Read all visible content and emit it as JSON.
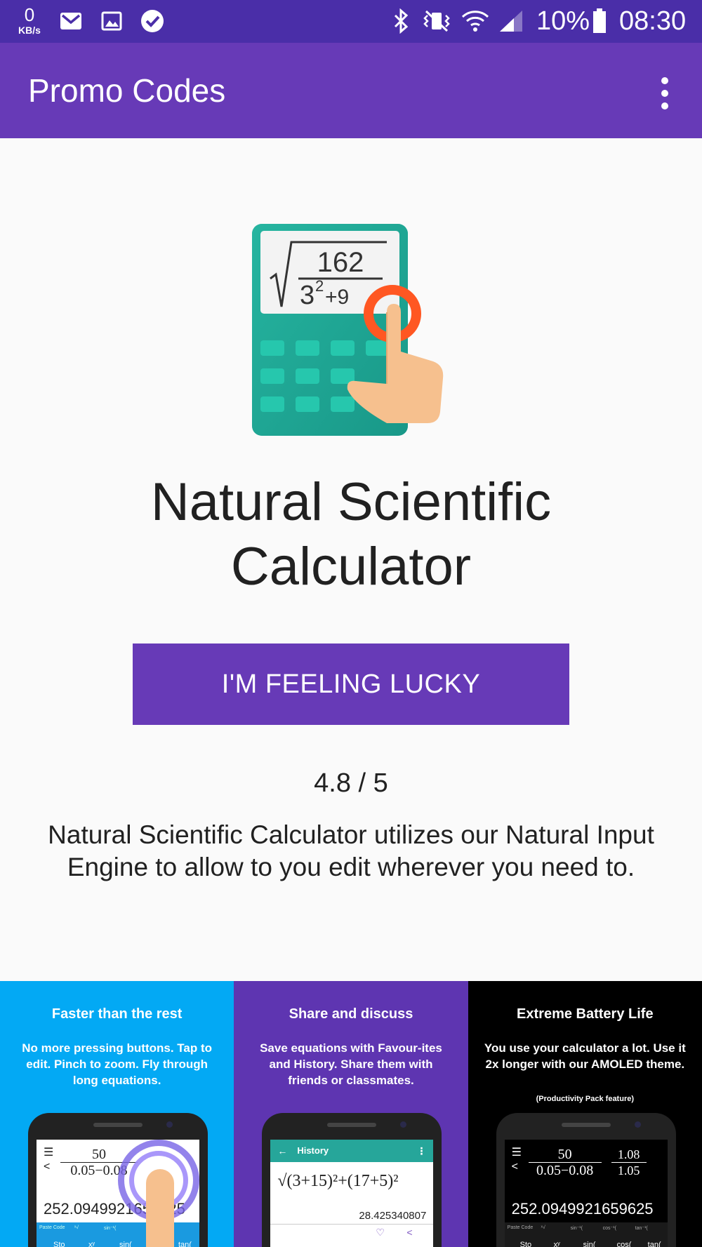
{
  "status_bar": {
    "net_speed_value": "0",
    "net_speed_unit": "KB/s",
    "battery": "10%",
    "time": "08:30",
    "icons": [
      "gmail-icon",
      "gallery-icon",
      "task-check-icon",
      "bluetooth-icon",
      "vibrate-icon",
      "wifi-icon",
      "signal-icon",
      "battery-icon"
    ]
  },
  "app_bar": {
    "title": "Promo Codes",
    "menu_icon": "more-vert-icon"
  },
  "app": {
    "logo_icon": "calculator-logo-icon",
    "logo_numerator": "162",
    "name": "Natural Scientific Calculator",
    "button_label": "I'M FEELING LUCKY",
    "rating": "4.8 / 5",
    "description": "Natural Scientific Calculator utilizes our Natural Input Engine to allow to you edit wherever you need to."
  },
  "screenshots": [
    {
      "heading": "Faster than the rest",
      "body": "No more pressing buttons. Tap to edit. Pinch to zoom. Fly through long equations.",
      "note": "",
      "result": "252.0949921659625",
      "numerator": "50",
      "denominator": "0.05−0.08",
      "keys": [
        "Sto",
        "xʸ",
        "sin(",
        "tan("
      ],
      "subkeys": [
        "Paste Code",
        "ˣ√",
        "sin⁻¹("
      ]
    },
    {
      "heading": "Share and discuss",
      "body": "Save equations with Favour-ites and History. Share them with friends or classmates.",
      "note": "",
      "history_title": "History",
      "expression": "√(3+15)²+(17+5)²",
      "result": "28.425340807"
    },
    {
      "heading": "Extreme Battery Life",
      "body": "You use your calculator a lot. Use it 2x longer with our AMOLED theme.",
      "note": "(Productivity Pack feature)",
      "result": "252.0949921659625",
      "numerator": "50",
      "denominator": "0.05−0.08",
      "inner_num": "1.08",
      "inner_den": "1.05",
      "keys": [
        "Sto",
        "xʸ",
        "sin(",
        "cos(",
        "tan("
      ],
      "subkeys": [
        "Paste Code",
        "ˣ√",
        "sin⁻¹(",
        "cos⁻¹(",
        "tan⁻¹("
      ]
    }
  ],
  "colors": {
    "status_bar": "#4a2ea8",
    "app_bar": "#673ab7",
    "button": "#673ab7",
    "panel_1": "#03a9f4",
    "panel_2": "#5e35b1",
    "panel_3": "#000000",
    "logo_teal": "#26a69a",
    "touch_orange": "#ff5722"
  }
}
